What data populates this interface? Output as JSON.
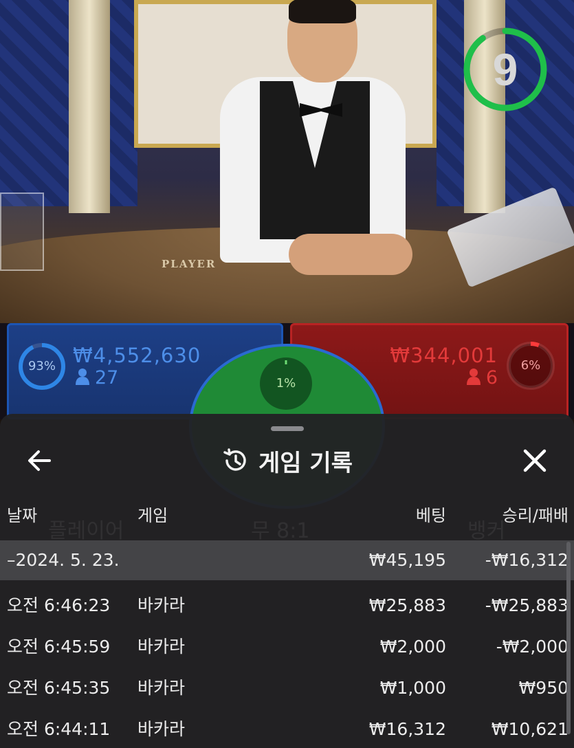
{
  "timer": {
    "value": "9",
    "progress": 0.9
  },
  "betting": {
    "player": {
      "percent": "93%",
      "amount": "₩4,552,630",
      "count": "27",
      "fraction": 0.93
    },
    "tie": {
      "percent": "1%"
    },
    "banker": {
      "percent": "6%",
      "amount": "₩344,001",
      "count": "6",
      "fraction": 0.06
    }
  },
  "history": {
    "title": "게임 기록",
    "columns": {
      "date": "날짜",
      "game": "게임",
      "bet": "베팅",
      "win_loss": "승리/패배"
    },
    "date_group": {
      "label": "–2024. 5. 23.",
      "bet": "₩45,195",
      "win_loss": "-₩16,312"
    },
    "rows": [
      {
        "time": "오전 6:46:23",
        "game": "바카라",
        "bet": "₩25,883",
        "win_loss": "-₩25,883"
      },
      {
        "time": "오전 6:45:59",
        "game": "바카라",
        "bet": "₩2,000",
        "win_loss": "-₩2,000"
      },
      {
        "time": "오전 6:45:35",
        "game": "바카라",
        "bet": "₩1,000",
        "win_loss": "₩950"
      },
      {
        "time": "오전 6:44:11",
        "game": "바카라",
        "bet": "₩16,312",
        "win_loss": "₩10,621"
      }
    ]
  },
  "icons": {
    "back": "arrow-left-icon",
    "history": "history-icon",
    "close": "close-icon",
    "user": "user-icon"
  },
  "colors": {
    "player": "#1c55b5",
    "banker": "#b92323",
    "tie": "#1f8a36",
    "timer": "#1fbf4a"
  }
}
